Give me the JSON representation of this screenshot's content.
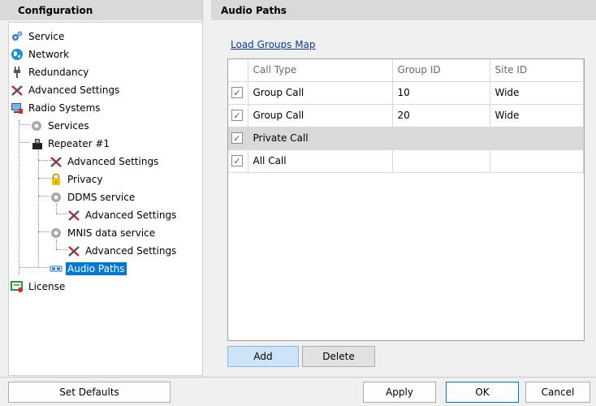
{
  "left": {
    "header": "Configuration",
    "tree": [
      {
        "label": "Service",
        "icon": "gears-icon"
      },
      {
        "label": "Network",
        "icon": "globe-icon"
      },
      {
        "label": "Redundancy",
        "icon": "plug-icon"
      },
      {
        "label": "Advanced Settings",
        "icon": "tools-icon"
      },
      {
        "label": "Radio Systems",
        "icon": "computer-icon"
      },
      {
        "label": "Services",
        "icon": "gear-icon"
      },
      {
        "label": "Repeater #1",
        "icon": "repeater-icon"
      },
      {
        "label": "Advanced Settings",
        "icon": "tools-icon"
      },
      {
        "label": "Privacy",
        "icon": "lock-icon"
      },
      {
        "label": "DDMS service",
        "icon": "gear-icon"
      },
      {
        "label": "Advanced Settings",
        "icon": "tools-icon"
      },
      {
        "label": "MNIS data service",
        "icon": "gear-icon"
      },
      {
        "label": "Advanced Settings",
        "icon": "tools-icon"
      },
      {
        "label": "Audio Paths",
        "icon": "audio-path-icon"
      },
      {
        "label": "License",
        "icon": "license-icon"
      }
    ]
  },
  "right": {
    "header": "Audio Paths",
    "link": "Load Groups Map",
    "columns": [
      "Call Type",
      "Group ID",
      "Site ID"
    ],
    "rows": [
      {
        "checked": "✓",
        "call_type": "Group Call",
        "group_id": "10",
        "site_id": "Wide"
      },
      {
        "checked": "✓",
        "call_type": "Group Call",
        "group_id": "20",
        "site_id": "Wide"
      },
      {
        "checked": "✓",
        "call_type": "Private Call",
        "group_id": "",
        "site_id": ""
      },
      {
        "checked": "✓",
        "call_type": "All Call",
        "group_id": "",
        "site_id": ""
      }
    ],
    "add_label": "Add",
    "delete_label": "Delete"
  },
  "bottom": {
    "set_defaults": "Set Defaults",
    "apply": "Apply",
    "ok": "OK",
    "cancel": "Cancel"
  },
  "colors": {
    "selection": "#0078d7",
    "link": "#0b3aa8",
    "header_bg": "#d9d9d9"
  }
}
